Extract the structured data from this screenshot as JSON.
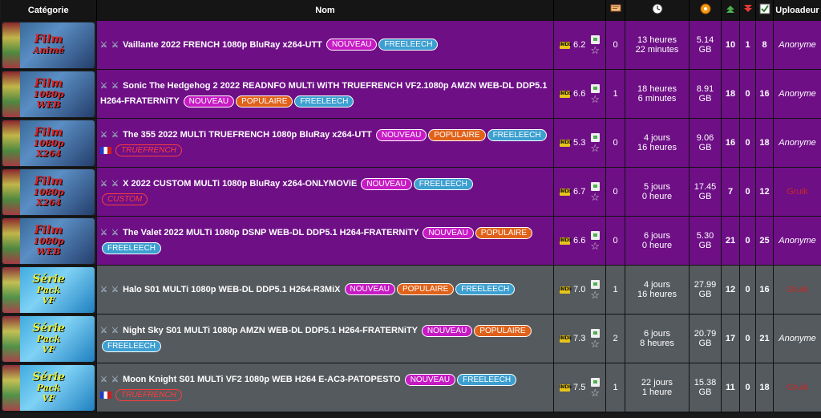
{
  "header": {
    "categorie": "Catégorie",
    "nom": "Nom",
    "uploadeur": "Uploadeur",
    "icons": [
      "comments-icon",
      "clock-icon",
      "size-icon",
      "seeders-icon",
      "leechers-icon",
      "completed-icon"
    ]
  },
  "rows": [
    {
      "kind": "film",
      "banner": [
        "Film",
        "Animé"
      ],
      "title": "Vaillante 2022 FRENCH 1080p BluRay x264-UTT",
      "badges": [
        {
          "t": "NOUVEAU",
          "c": "nouveau"
        },
        {
          "t": "FREELEECH",
          "c": "free"
        }
      ],
      "tag": null,
      "flag": false,
      "rating": "6.2",
      "comments": "0",
      "age1": "13 heures",
      "age2": "22 minutes",
      "size1": "5.14",
      "size2": "GB",
      "seed": "10",
      "leech": "1",
      "done": "8",
      "uploader": "Anonyme",
      "uploader_type": "anon"
    },
    {
      "kind": "film",
      "banner": [
        "Film",
        "1080p",
        "WEB"
      ],
      "title": "Sonic The Hedgehog 2 2022 READNFO MULTi WiTH TRUEFRENCH VF2.1080p AMZN WEB-DL DDP5.1 H264-FRATERNiTY",
      "badges": [
        {
          "t": "NOUVEAU",
          "c": "nouveau"
        },
        {
          "t": "POPULAIRE",
          "c": "populaire"
        },
        {
          "t": "FREELEECH",
          "c": "free"
        }
      ],
      "tag": null,
      "flag": false,
      "rating": "6.6",
      "comments": "1",
      "age1": "18 heures",
      "age2": "6 minutes",
      "size1": "8.91",
      "size2": "GB",
      "seed": "18",
      "leech": "0",
      "done": "16",
      "uploader": "Anonyme",
      "uploader_type": "anon"
    },
    {
      "kind": "film",
      "banner": [
        "Film",
        "1080p",
        "X264"
      ],
      "title": "The 355 2022 MULTi TRUEFRENCH 1080p BluRay x264-UTT",
      "badges": [
        {
          "t": "NOUVEAU",
          "c": "nouveau"
        },
        {
          "t": "POPULAIRE",
          "c": "populaire"
        },
        {
          "t": "FREELEECH",
          "c": "free"
        }
      ],
      "tag": "TRUEFRENCH",
      "flag": true,
      "rating": "5.3",
      "comments": "0",
      "age1": "4 jours",
      "age2": "16 heures",
      "size1": "9.06",
      "size2": "GB",
      "seed": "16",
      "leech": "0",
      "done": "18",
      "uploader": "Anonyme",
      "uploader_type": "anon"
    },
    {
      "kind": "film",
      "banner": [
        "Film",
        "1080p",
        "X264"
      ],
      "title": "X 2022 CUSTOM MULTi 1080p BluRay x264-ONLYMOViE",
      "badges": [
        {
          "t": "NOUVEAU",
          "c": "nouveau"
        },
        {
          "t": "FREELEECH",
          "c": "free"
        }
      ],
      "tag": "CUSTOM",
      "flag": false,
      "rating": "6.7",
      "comments": "0",
      "age1": "5 jours",
      "age2": "0 heure",
      "size1": "17.45",
      "size2": "GB",
      "seed": "7",
      "leech": "0",
      "done": "12",
      "uploader": "Gruik",
      "uploader_type": "gruik"
    },
    {
      "kind": "film",
      "banner": [
        "Film",
        "1080p",
        "WEB"
      ],
      "title": "The Valet 2022 MULTi 1080p DSNP WEB-DL DDP5.1 H264-FRATERNiTY",
      "badges": [
        {
          "t": "NOUVEAU",
          "c": "nouveau"
        },
        {
          "t": "POPULAIRE",
          "c": "populaire"
        },
        {
          "t": "FREELEECH",
          "c": "free"
        }
      ],
      "tag": null,
      "flag": false,
      "rating": "6.6",
      "comments": "0",
      "age1": "6 jours",
      "age2": "0 heure",
      "size1": "5.30",
      "size2": "GB",
      "seed": "21",
      "leech": "0",
      "done": "25",
      "uploader": "Anonyme",
      "uploader_type": "anon"
    },
    {
      "kind": "serie",
      "banner": [
        "Série",
        "Pack",
        "VF"
      ],
      "title": "Halo S01 MULTi 1080p WEB-DL DDP5.1 H264-R3MiX",
      "badges": [
        {
          "t": "NOUVEAU",
          "c": "nouveau"
        },
        {
          "t": "POPULAIRE",
          "c": "populaire"
        },
        {
          "t": "FREELEECH",
          "c": "free"
        }
      ],
      "tag": null,
      "flag": false,
      "rating": "7.0",
      "comments": "1",
      "age1": "4 jours",
      "age2": "16 heures",
      "size1": "27.99",
      "size2": "GB",
      "seed": "12",
      "leech": "0",
      "done": "16",
      "uploader": "Gruik",
      "uploader_type": "gruik"
    },
    {
      "kind": "serie",
      "banner": [
        "Série",
        "Pack",
        "VF"
      ],
      "title": "Night Sky S01 MULTi 1080p AMZN WEB-DL DDP5.1 H264-FRATERNiTY",
      "badges": [
        {
          "t": "NOUVEAU",
          "c": "nouveau"
        },
        {
          "t": "POPULAIRE",
          "c": "populaire"
        },
        {
          "t": "FREELEECH",
          "c": "free"
        }
      ],
      "tag": null,
      "flag": false,
      "rating": "7.3",
      "comments": "2",
      "age1": "6 jours",
      "age2": "8 heures",
      "size1": "20.79",
      "size2": "GB",
      "seed": "17",
      "leech": "0",
      "done": "21",
      "uploader": "Anonyme",
      "uploader_type": "anon"
    },
    {
      "kind": "serie",
      "banner": [
        "Série",
        "Pack",
        "VF"
      ],
      "title": "Moon Knight S01 MULTi VF2 1080p WEB H264 E-AC3-PATOPESTO",
      "badges": [
        {
          "t": "NOUVEAU",
          "c": "nouveau"
        },
        {
          "t": "FREELEECH",
          "c": "free"
        }
      ],
      "tag": "TRUEFRENCH",
      "flag": true,
      "rating": "7.5",
      "comments": "1",
      "age1": "22 jours",
      "age2": "1 heure",
      "size1": "15.38",
      "size2": "GB",
      "seed": "11",
      "leech": "0",
      "done": "18",
      "uploader": "Gruik",
      "uploader_type": "gruik"
    }
  ]
}
